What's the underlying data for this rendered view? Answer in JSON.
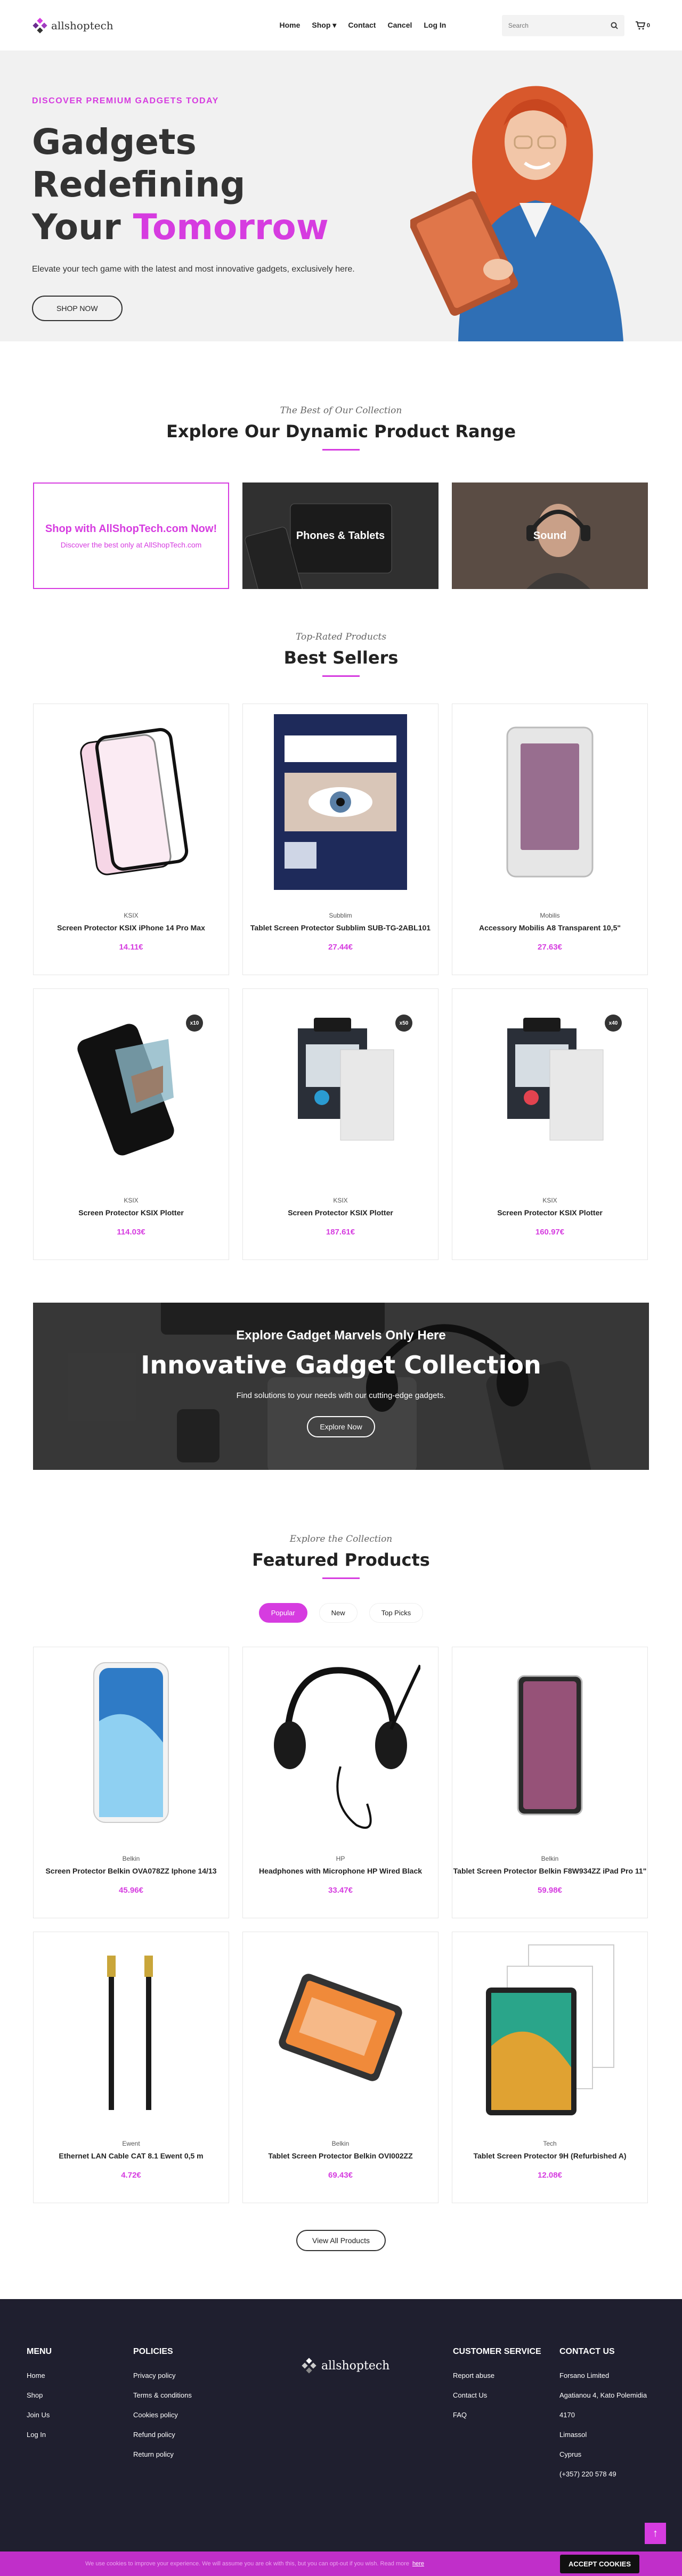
{
  "header": {
    "logo_text": "allshoptech",
    "nav": [
      "Home",
      "Shop",
      "Contact",
      "Cancel",
      "Log In"
    ],
    "search_placeholder": "Search",
    "cart_count": "0"
  },
  "hero": {
    "eyebrow": "DISCOVER PREMIUM GADGETS TODAY",
    "title_line1": "Gadgets Redefining",
    "title_line2_plain": "Your",
    "title_line2_accent": "Tomorrow",
    "subtitle": "Elevate your tech game with the latest and most innovative gadgets, exclusively here.",
    "cta": "SHOP NOW"
  },
  "range": {
    "eyebrow": "The Best of Our Collection",
    "title": "Explore Our Dynamic Product Range",
    "tile_shop_title": "Shop with AllShopTech.com Now!",
    "tile_shop_sub": "Discover the best only at AllShopTech.com",
    "tile_phones": "Phones & Tablets",
    "tile_sound": "Sound"
  },
  "sellers": {
    "eyebrow": "Top-Rated Products",
    "title": "Best Sellers",
    "products": [
      {
        "brand": "KSIX",
        "name": "Screen Protector KSIX iPhone 14 Pro Max",
        "price": "14.11€"
      },
      {
        "brand": "Subblim",
        "name": "Tablet Screen Protector Subblim SUB-TG-2ABL101",
        "price": "27.44€"
      },
      {
        "brand": "Mobilis",
        "name": "Accessory Mobilis A8 Transparent 10,5\"",
        "price": "27.63€"
      },
      {
        "brand": "KSIX",
        "name": "Screen Protector KSIX Plotter",
        "price": "114.03€",
        "badge": "x10"
      },
      {
        "brand": "KSIX",
        "name": "Screen Protector KSIX Plotter",
        "price": "187.61€",
        "badge": "x50"
      },
      {
        "brand": "KSIX",
        "name": "Screen Protector KSIX Plotter",
        "price": "160.97€",
        "badge": "x40"
      }
    ]
  },
  "banner": {
    "eyebrow": "Explore Gadget Marvels Only Here",
    "title": "Innovative Gadget Collection",
    "subtitle": "Find solutions to your needs with our cutting-edge gadgets.",
    "cta": "Explore Now"
  },
  "featured": {
    "eyebrow": "Explore the Collection",
    "title": "Featured Products",
    "tabs": [
      "Popular",
      "New",
      "Top Picks"
    ],
    "products": [
      {
        "brand": "Belkin",
        "name": "Screen Protector Belkin OVA078ZZ Iphone 14/13",
        "price": "45.96€"
      },
      {
        "brand": "HP",
        "name": "Headphones with Microphone HP Wired Black",
        "price": "33.47€"
      },
      {
        "brand": "Belkin",
        "name": "Tablet Screen Protector Belkin F8W934ZZ iPad Pro 11\"",
        "price": "59.98€"
      },
      {
        "brand": "Ewent",
        "name": "Ethernet LAN Cable CAT 8.1 Ewent 0,5 m",
        "price": "4.72€"
      },
      {
        "brand": "Belkin",
        "name": "Tablet Screen Protector Belkin OVI002ZZ",
        "price": "69.43€"
      },
      {
        "brand": "Tech",
        "name": "Tablet Screen Protector 9H (Refurbished A)",
        "price": "12.08€"
      }
    ],
    "view_all": "View All Products"
  },
  "footer": {
    "menu_title": "MENU",
    "menu": [
      "Home",
      "Shop",
      "Join Us",
      "Log In"
    ],
    "policies_title": "POLICIES",
    "policies": [
      "Privacy policy",
      "Terms & conditions",
      "Cookies policy",
      "Refund policy",
      "Return policy"
    ],
    "logo_text": "allshoptech",
    "service_title": "CUSTOMER SERVICE",
    "service": [
      "Report abuse",
      "Contact Us",
      "FAQ"
    ],
    "contact_title": "CONTACT US",
    "contact": [
      "Forsano Limited",
      "Agatianou 4, Kato Polemidia",
      "4170",
      "Limassol",
      "Cyprus",
      "(+357) 220 578 49"
    ]
  },
  "cookie": {
    "message": "We use cookies to improve your experience. We will assume you are ok with this, but you can opt-out if you wish. Read more",
    "link": "here",
    "accept": "ACCEPT COOKIES"
  },
  "colors": {
    "accent": "#d63ce0",
    "footer_bg": "#1f1f2f"
  }
}
